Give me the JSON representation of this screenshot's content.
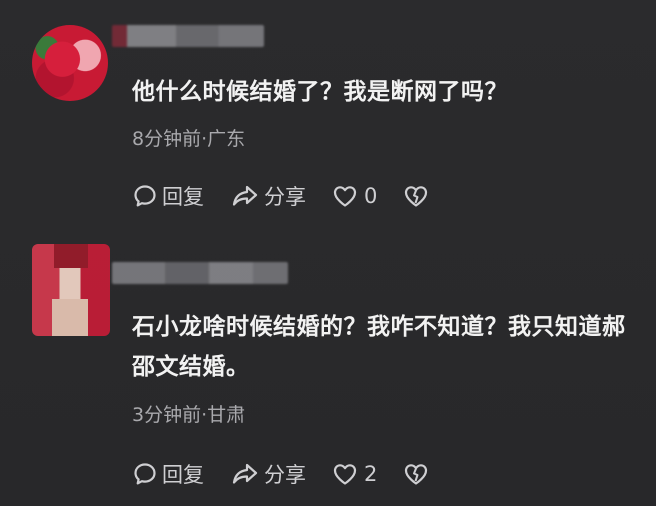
{
  "comments": [
    {
      "text": "他什么时候结婚了？我是断网了吗？",
      "meta": "8分钟前·广东",
      "reply_label": "回复",
      "share_label": "分享",
      "like_count": "0"
    },
    {
      "text": "石小龙啥时候结婚的？我咋不知道？我只知道郝邵文结婚。",
      "meta": "3分钟前·甘肃",
      "reply_label": "回复",
      "share_label": "分享",
      "like_count": "2"
    }
  ],
  "icons": {
    "reply": "comment-bubble-icon",
    "share": "share-arrow-icon",
    "like": "heart-icon",
    "dislike": "broken-heart-icon"
  },
  "colors": {
    "background": "#2a2a2c",
    "text": "#f2f2f2",
    "meta": "#a9a9ad",
    "action": "#cfcfd2"
  }
}
